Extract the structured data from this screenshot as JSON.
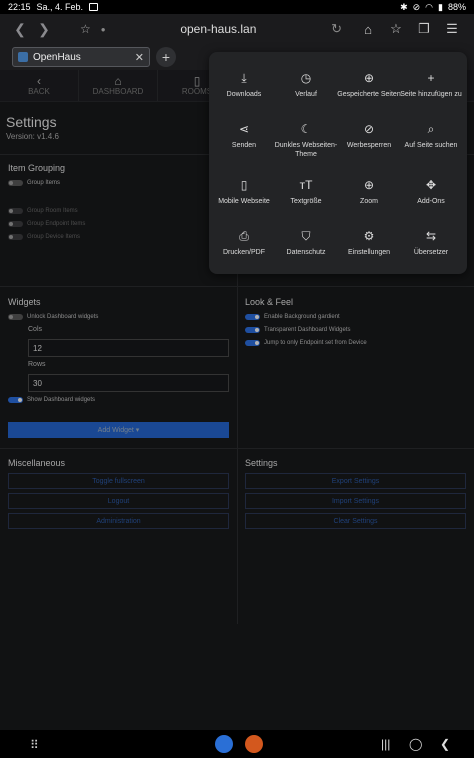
{
  "status": {
    "time": "22:15",
    "date": "Sa., 4. Feb.",
    "battery": "88%"
  },
  "browser": {
    "host": "open-haus.lan",
    "tab_title": "OpenHaus",
    "icons": {
      "back": "arrow-left-icon",
      "forward": "arrow-right-icon",
      "bookmark": "star-icon",
      "reload": "reload-icon",
      "home": "home-icon",
      "bookmarks": "star-outline-icon",
      "tabs": "tabs-icon",
      "menu": "hamburger-icon"
    }
  },
  "nav": {
    "items": [
      {
        "label": "BACK",
        "icon": "chevron-left-icon"
      },
      {
        "label": "DASHBOARD",
        "icon": "home-icon"
      },
      {
        "label": "ROOMS",
        "icon": "door-icon"
      }
    ]
  },
  "page": {
    "title": "Settings",
    "version": "Version: v1.4.6",
    "item_grouping": {
      "heading": "Item Grouping",
      "options": [
        "Group Items",
        "Group Room Items",
        "Group Endpoint Items",
        "Group Device Items"
      ]
    },
    "widgets": {
      "heading": "Widgets",
      "unlock_label": "Unlock Dashboard widgets",
      "cols_label": "Cols",
      "cols_value": "12",
      "rows_label": "Rows",
      "rows_value": "30",
      "show_label": "Show Dashboard widgets",
      "add_button": "Add Widget ▾"
    },
    "look_feel": {
      "heading": "Look & Feel",
      "options": [
        "Enable Background gardient",
        "Transparent Dashboard Widgets",
        "Jump to only Endpoint set from Device"
      ]
    },
    "misc": {
      "heading": "Miscellaneous",
      "buttons": [
        "Toggle fullscreen",
        "Logout",
        "Administration"
      ]
    },
    "settings": {
      "heading": "Settings",
      "buttons": [
        "Export Settings",
        "Import Settings",
        "Clear Settings"
      ]
    }
  },
  "menu": {
    "items": [
      {
        "label": "Downloads",
        "icon": "download-icon",
        "glyph": "⤓"
      },
      {
        "label": "Verlauf",
        "icon": "history-icon",
        "glyph": "◷"
      },
      {
        "label": "Gespeicherte Seiten",
        "icon": "globe-icon",
        "glyph": "⊕"
      },
      {
        "label": "Seite hinzufügen zu",
        "icon": "plus-icon",
        "glyph": "+"
      },
      {
        "label": "Senden",
        "icon": "share-icon",
        "glyph": "⋖"
      },
      {
        "label": "Dunkles Webseiten-Theme",
        "icon": "moon-icon",
        "glyph": "☾"
      },
      {
        "label": "Werbesperren",
        "icon": "block-icon",
        "glyph": "⊘"
      },
      {
        "label": "Auf Seite suchen",
        "icon": "find-icon",
        "glyph": "⌕"
      },
      {
        "label": "Mobile Webseite",
        "icon": "phone-icon",
        "glyph": "▯"
      },
      {
        "label": "Textgröße",
        "icon": "text-size-icon",
        "glyph": "ᴛT"
      },
      {
        "label": "Zoom",
        "icon": "zoom-icon",
        "glyph": "⊕"
      },
      {
        "label": "Add-Ons",
        "icon": "puzzle-icon",
        "glyph": "✥"
      },
      {
        "label": "Drucken/PDF",
        "icon": "print-icon",
        "glyph": "⎙"
      },
      {
        "label": "Datenschutz",
        "icon": "shield-icon",
        "glyph": "⛉"
      },
      {
        "label": "Einstellungen",
        "icon": "gear-icon",
        "glyph": "⚙"
      },
      {
        "label": "Übersetzer",
        "icon": "translate-icon",
        "glyph": "⇆"
      }
    ]
  },
  "colors": {
    "accent": "#2a6ad6",
    "menu_bg": "#232426",
    "page_bg": "#17181a"
  }
}
